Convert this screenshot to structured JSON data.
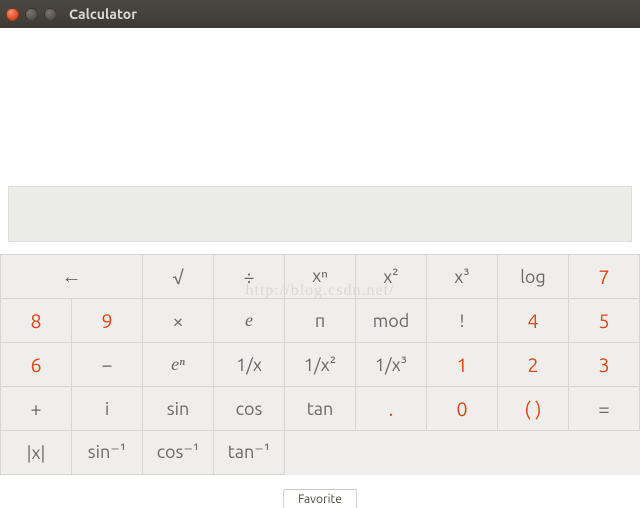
{
  "window": {
    "title": "Calculator"
  },
  "watermark": "http://blog.csdn.net/",
  "display": {
    "value": ""
  },
  "keys": {
    "r0": {
      "back": "←",
      "sqrt": "√",
      "div": "÷",
      "xn": "xⁿ",
      "x2": "x²",
      "x3": "x³",
      "log": "log"
    },
    "r1": {
      "d7": "7",
      "d8": "8",
      "d9": "9",
      "mul": "×",
      "e": "e",
      "pi": "π",
      "mod": "mod",
      "fact": "!"
    },
    "r2": {
      "d4": "4",
      "d5": "5",
      "d6": "6",
      "sub": "−",
      "en": "eⁿ",
      "inv": "1/x",
      "inv2": "1/x²",
      "inv3": "1/x³"
    },
    "r3": {
      "d1": "1",
      "d2": "2",
      "d3": "3",
      "add": "+",
      "i": "i",
      "sin": "sin",
      "cos": "cos",
      "tan": "tan"
    },
    "r4": {
      "dot": ".",
      "d0": "0",
      "paren": "( )",
      "eq": "=",
      "abs": "|x|",
      "asin": "sin⁻¹",
      "acos": "cos⁻¹",
      "atan": "tan⁻¹"
    }
  },
  "favorite": {
    "label": "Favorite"
  }
}
